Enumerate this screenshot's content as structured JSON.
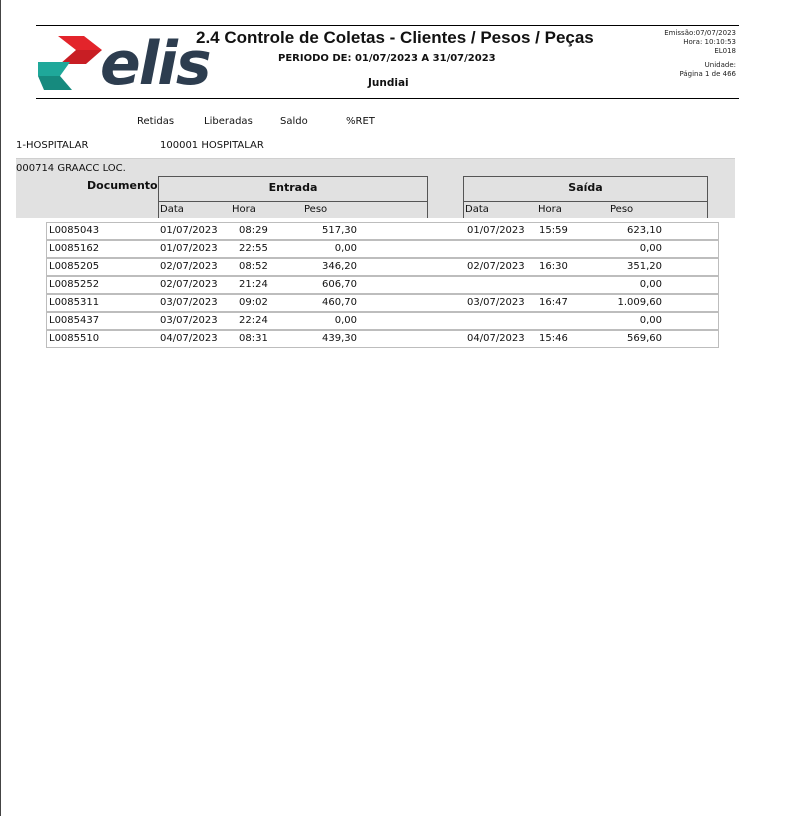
{
  "header": {
    "title": "2.4 Controle de Coletas - Clientes / Pesos / Peças",
    "period": "PERIODO DE: 01/07/2023 A 31/07/2023",
    "city": "Jundiai",
    "emissao_label": "Emissão:",
    "emissao_value": "07/07/2023",
    "hora_label": "Hora:",
    "hora_value": "10:10:53",
    "user": "EL018",
    "unidade_label": "Unidade:",
    "pagina": "Página 1 de 466"
  },
  "logo": {
    "text": "elis",
    "colors": {
      "red": "#e3242b",
      "teal": "#1fa89a",
      "dark": "#2d3d4f"
    }
  },
  "summary_headers": [
    "Retidas",
    "Liberadas",
    "Saldo",
    "%RET"
  ],
  "group": {
    "code": "1-HOSPITALAR",
    "sub": "100001 HOSPITALAR"
  },
  "client": "000714 GRAACC LOC.",
  "table": {
    "document_label": "Documento",
    "entrada_label": "Entrada",
    "saida_label": "Saída",
    "columns": {
      "data": "Data",
      "hora": "Hora",
      "peso": "Peso"
    },
    "rows": [
      {
        "doc": "L0085043",
        "e_data": "01/07/2023",
        "e_hora": "08:29",
        "e_peso": "517,30",
        "s_data": "01/07/2023",
        "s_hora": "15:59",
        "s_peso": "623,10"
      },
      {
        "doc": "L0085162",
        "e_data": "01/07/2023",
        "e_hora": "22:55",
        "e_peso": "0,00",
        "s_data": "",
        "s_hora": "",
        "s_peso": "0,00"
      },
      {
        "doc": "L0085205",
        "e_data": "02/07/2023",
        "e_hora": "08:52",
        "e_peso": "346,20",
        "s_data": "02/07/2023",
        "s_hora": "16:30",
        "s_peso": "351,20"
      },
      {
        "doc": "L0085252",
        "e_data": "02/07/2023",
        "e_hora": "21:24",
        "e_peso": "606,70",
        "s_data": "",
        "s_hora": "",
        "s_peso": "0,00"
      },
      {
        "doc": "L0085311",
        "e_data": "03/07/2023",
        "e_hora": "09:02",
        "e_peso": "460,70",
        "s_data": "03/07/2023",
        "s_hora": "16:47",
        "s_peso": "1.009,60"
      },
      {
        "doc": "L0085437",
        "e_data": "03/07/2023",
        "e_hora": "22:24",
        "e_peso": "0,00",
        "s_data": "",
        "s_hora": "",
        "s_peso": "0,00"
      },
      {
        "doc": "L0085510",
        "e_data": "04/07/2023",
        "e_hora": "08:31",
        "e_peso": "439,30",
        "s_data": "04/07/2023",
        "s_hora": "15:46",
        "s_peso": "569,60"
      }
    ]
  }
}
